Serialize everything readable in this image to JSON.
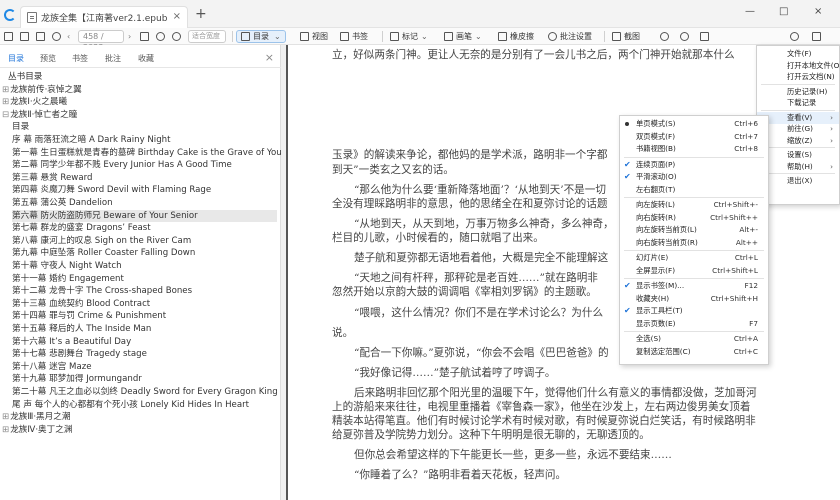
{
  "window": {
    "tab_title": "龙族全集【江南著ver2.1.epub",
    "tab_close": "×",
    "new_tab": "+",
    "controls": [
      "—",
      "□",
      "×"
    ]
  },
  "toolbar": {
    "page_current": "458",
    "page_total": "/ 2038",
    "zoom_placeholder": "适合宽度",
    "toc": "目录",
    "view": "视图",
    "bookmark": "书签",
    "mark": "标记",
    "brush": "画笔",
    "eraser": "橡皮擦",
    "annotation_settings": "批注设置",
    "screenshot": "截图"
  },
  "left_panel": {
    "tabs": [
      "目录",
      "预览",
      "书签",
      "批注",
      "收藏"
    ],
    "active_tab": "目录",
    "toc": [
      {
        "text": "丛书目录",
        "level": 0,
        "expander": ""
      },
      {
        "text": "龙族前传·哀悼之翼",
        "level": 0,
        "expander": "⊞"
      },
      {
        "text": "龙族Ⅰ·火之晨曦",
        "level": 0,
        "expander": "⊞"
      },
      {
        "text": "龙族Ⅱ·悼亡者之瞳",
        "level": 0,
        "expander": "⊟"
      },
      {
        "text": "目录",
        "level": 1,
        "expander": ""
      },
      {
        "text": "序 幕 雨落狂流之暗 A Dark Rainy Night",
        "level": 1,
        "expander": ""
      },
      {
        "text": "第一幕 生日蛋糕就是青春的墓碑 Birthday Cake is the Grave of Youth",
        "level": 1,
        "expander": ""
      },
      {
        "text": "第二幕 同学少年都不贱 Every Junior Has A Good Time",
        "level": 1,
        "expander": ""
      },
      {
        "text": "第三幕 悬赏 Reward",
        "level": 1,
        "expander": ""
      },
      {
        "text": "第四幕 炎魔刀舞 Sword Devil with Flaming Rage",
        "level": 1,
        "expander": ""
      },
      {
        "text": "第五幕 蒲公英 Dandelion",
        "level": 1,
        "expander": ""
      },
      {
        "text": "第六幕 防火防盗防师兄 Beware of Your Senior",
        "level": 1,
        "expander": ""
      },
      {
        "text": "第七幕 群龙的盛宴 Dragons’ Feast",
        "level": 1,
        "expander": ""
      },
      {
        "text": "第八幕 康河上的叹息 Sigh on the River Cam",
        "level": 1,
        "expander": ""
      },
      {
        "text": "第九幕 中庭坠落 Roller Coaster Falling Down",
        "level": 1,
        "expander": ""
      },
      {
        "text": "第十幕 守夜人 Night Watch",
        "level": 1,
        "expander": ""
      },
      {
        "text": "第十一幕 婚约 Engagement",
        "level": 1,
        "expander": ""
      },
      {
        "text": "第十二幕 龙骨十字 The Cross-shaped Bones",
        "level": 1,
        "expander": ""
      },
      {
        "text": "第十三幕 血统契约 Blood Contract",
        "level": 1,
        "expander": ""
      },
      {
        "text": "第十四幕 罪与罚 Crime & Punishment",
        "level": 1,
        "expander": ""
      },
      {
        "text": "第十五幕 释后的人 The Inside Man",
        "level": 1,
        "expander": ""
      },
      {
        "text": "第十六幕 It’s a Beautiful Day",
        "level": 1,
        "expander": ""
      },
      {
        "text": "第十七幕 悲剧舞台 Tragedy stage",
        "level": 1,
        "expander": ""
      },
      {
        "text": "第十八幕 迷宫 Maze",
        "level": 1,
        "expander": ""
      },
      {
        "text": "第十九幕 耶梦加得 Jormungandr",
        "level": 1,
        "expander": ""
      },
      {
        "text": "第二十幕 凡王之血必以剑终 Deadly Sword for Every Gragon King",
        "level": 1,
        "expander": ""
      },
      {
        "text": "尾 声 每个人的心都都有个死小孩 Lonely Kid Hides In Heart",
        "level": 1,
        "expander": ""
      },
      {
        "text": "龙族Ⅲ·黑月之潮",
        "level": 0,
        "expander": "⊞"
      },
      {
        "text": "龙族Ⅳ·奥丁之渊",
        "level": 0,
        "expander": "⊞"
      }
    ],
    "selected_index": 11
  },
  "reader": {
    "lines": [
      "立，好似两条门神。更让人无奈的是分别有了一会儿书之后，两个门神开始就那本什么",
      "",
      "",
      "",
      "",
      "",
      "玉录》的解读来争论，都他妈的是学术派，路明非一个字都",
      "到天”一类玄之又玄的话。",
      "“那么他为什么要‘重新降落地面’？‘从地到天’不是一切",
      "全没有理睬路明非的意思，他的思绪全在和夏弥讨论的话题",
      "“从地到天，从天到地，万事万物多么神奇，多么神奇，",
      "栏目的儿歌，小时候看的，随口就唱了出来。",
      "楚子航和夏弥都无语地看着他，大概是完全不能理解这",
      "“天地之间有杆秤，那秤砣是老百姓……”就在路明非",
      "忽然开始以京韵大鼓的调调唱《宰相刘罗锅》的主题歌。",
      "“喂喂，这什么情况？你们不是在学术讨论么？为什么",
      "说。",
      "“配合一下你嘛。”夏弥说，“你会不会唱《巴巴爸爸》的",
      "“我好像记得……”楚子航试着哼了哼调子。",
      "后来路明非回忆那个阳光里的温暖下午，觉得他们什么有意义的事情都没做，芝加哥河",
      "上的游船来来往往，电视里重播着《宰鲁森一家》，他坐在沙发上，左右两边俊男美女顶着",
      "精装本站得笔直。他们有时候讨论学术有时候对歌，有时候夏弥说白烂笑话，有时候路明非",
      "给夏弥普及学院势力划分。这种下午明明是很无聊的，无聊透顶的。",
      "但你总会希望这样的下午能更长一些，更多一些，永远不要结束……",
      "“你睡着了么？”路明非看着天花板，轻声问。"
    ]
  },
  "context_menu": {
    "items": [
      {
        "label": "单页模式(S)",
        "key": "Ctrl+6",
        "mark": "dot"
      },
      {
        "label": "双页模式(F)",
        "key": "Ctrl+7",
        "mark": ""
      },
      {
        "label": "书籍视图(B)",
        "key": "Ctrl+8",
        "mark": ""
      },
      {
        "sep": true
      },
      {
        "label": "连续页面(P)",
        "key": "",
        "mark": "check"
      },
      {
        "label": "平滑滚动(O)",
        "key": "",
        "mark": "check"
      },
      {
        "label": "左右翻页(T)",
        "key": "",
        "mark": ""
      },
      {
        "sep": true
      },
      {
        "label": "向左旋转(L)",
        "key": "Ctrl+Shift+-",
        "mark": ""
      },
      {
        "label": "向右旋转(R)",
        "key": "Ctrl+Shift++",
        "mark": ""
      },
      {
        "label": "向左旋转当前页(L)",
        "key": "Alt+-",
        "mark": ""
      },
      {
        "label": "向右旋转当前页(R)",
        "key": "Alt++",
        "mark": ""
      },
      {
        "sep": true
      },
      {
        "label": "幻灯片(E)",
        "key": "Ctrl+L",
        "mark": ""
      },
      {
        "label": "全屏显示(F)",
        "key": "Ctrl+Shift+L",
        "mark": ""
      },
      {
        "sep": true
      },
      {
        "label": "显示书签(M)...",
        "key": "F12",
        "mark": "check"
      },
      {
        "label": "收藏夹(H)",
        "key": "Ctrl+Shift+H",
        "mark": ""
      },
      {
        "label": "显示工具栏(T)",
        "key": "",
        "mark": "check"
      },
      {
        "label": "显示页数(E)",
        "key": "F7",
        "mark": ""
      },
      {
        "sep": true
      },
      {
        "label": "全选(S)",
        "key": "Ctrl+A",
        "mark": ""
      },
      {
        "label": "复制选定范围(C)",
        "key": "Ctrl+C",
        "mark": ""
      }
    ]
  },
  "main_menu": {
    "items": [
      {
        "label": "文件(F)",
        "arrow": ""
      },
      {
        "label": "打开本地文件(O)",
        "arrow": ""
      },
      {
        "label": "打开云文档(N)",
        "arrow": ""
      },
      {
        "sep": true
      },
      {
        "label": "历史记录(H)",
        "arrow": ""
      },
      {
        "label": "下载记录",
        "arrow": ""
      },
      {
        "sep": true
      },
      {
        "label": "查看(V)",
        "arrow": "›"
      },
      {
        "label": "前往(G)",
        "arrow": "›"
      },
      {
        "label": "缩放(Z)",
        "arrow": "›"
      },
      {
        "sep": true
      },
      {
        "label": "设置(S)",
        "arrow": ""
      },
      {
        "label": "帮助(H)",
        "arrow": "›"
      },
      {
        "sep": true
      },
      {
        "label": "退出(X)",
        "arrow": ""
      }
    ],
    "highlighted_index": 7
  }
}
